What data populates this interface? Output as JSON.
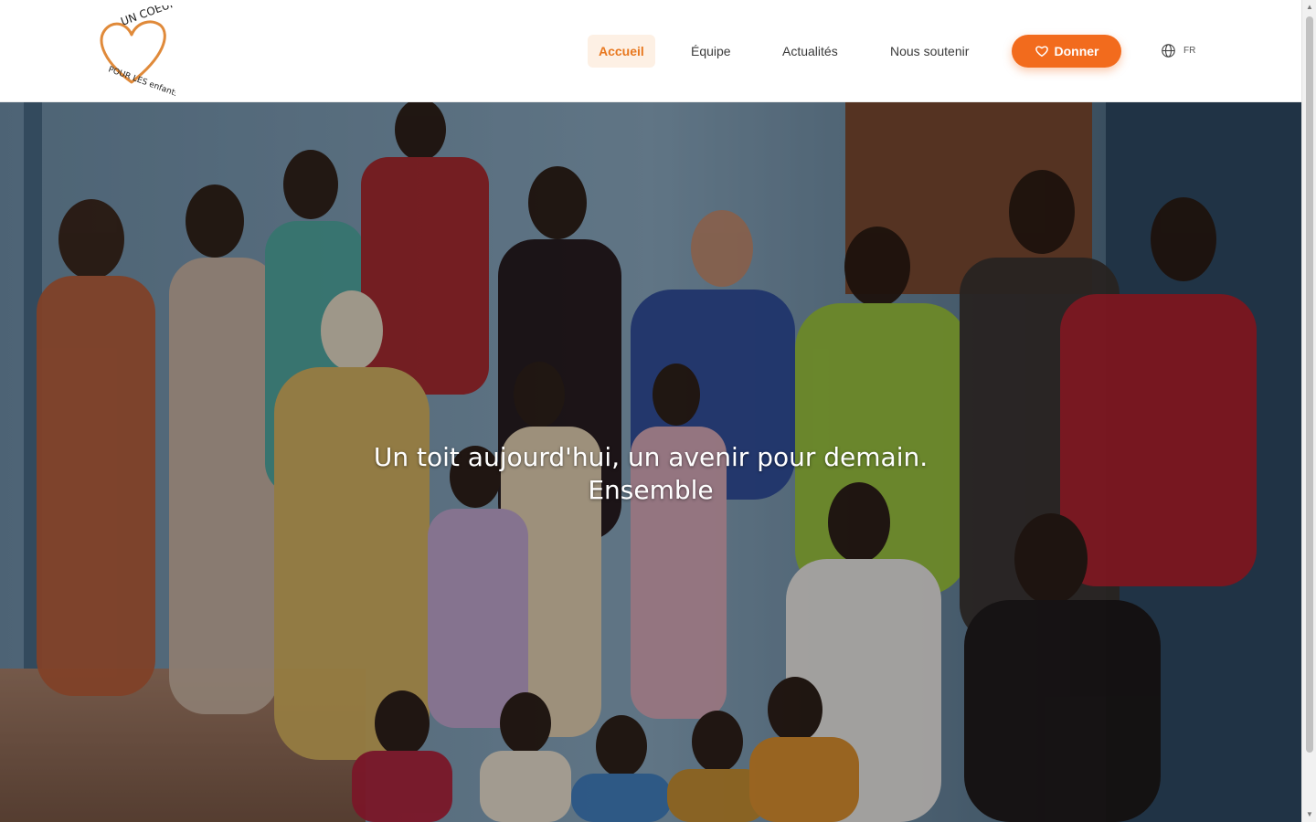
{
  "brand": {
    "logo_line1": "UN COEUR",
    "logo_line2": "POUR LES enfants",
    "accent_color": "#f26b1d",
    "logo_color": "#e08a3a"
  },
  "nav": {
    "items": [
      {
        "label": "Accueil",
        "active": true
      },
      {
        "label": "Équipe",
        "active": false
      },
      {
        "label": "Actualités",
        "active": false
      },
      {
        "label": "Nous soutenir",
        "active": false
      }
    ],
    "donate_label": "Donner",
    "donate_icon": "heart-icon",
    "language": "FR",
    "language_icon": "globe-icon"
  },
  "hero": {
    "title_line1": "Un toit aujourd'hui, un avenir pour demain.",
    "title_line2": "Ensemble"
  },
  "scrollbar": {
    "up_icon": "arrow-up-icon",
    "down_icon": "arrow-down-icon"
  }
}
